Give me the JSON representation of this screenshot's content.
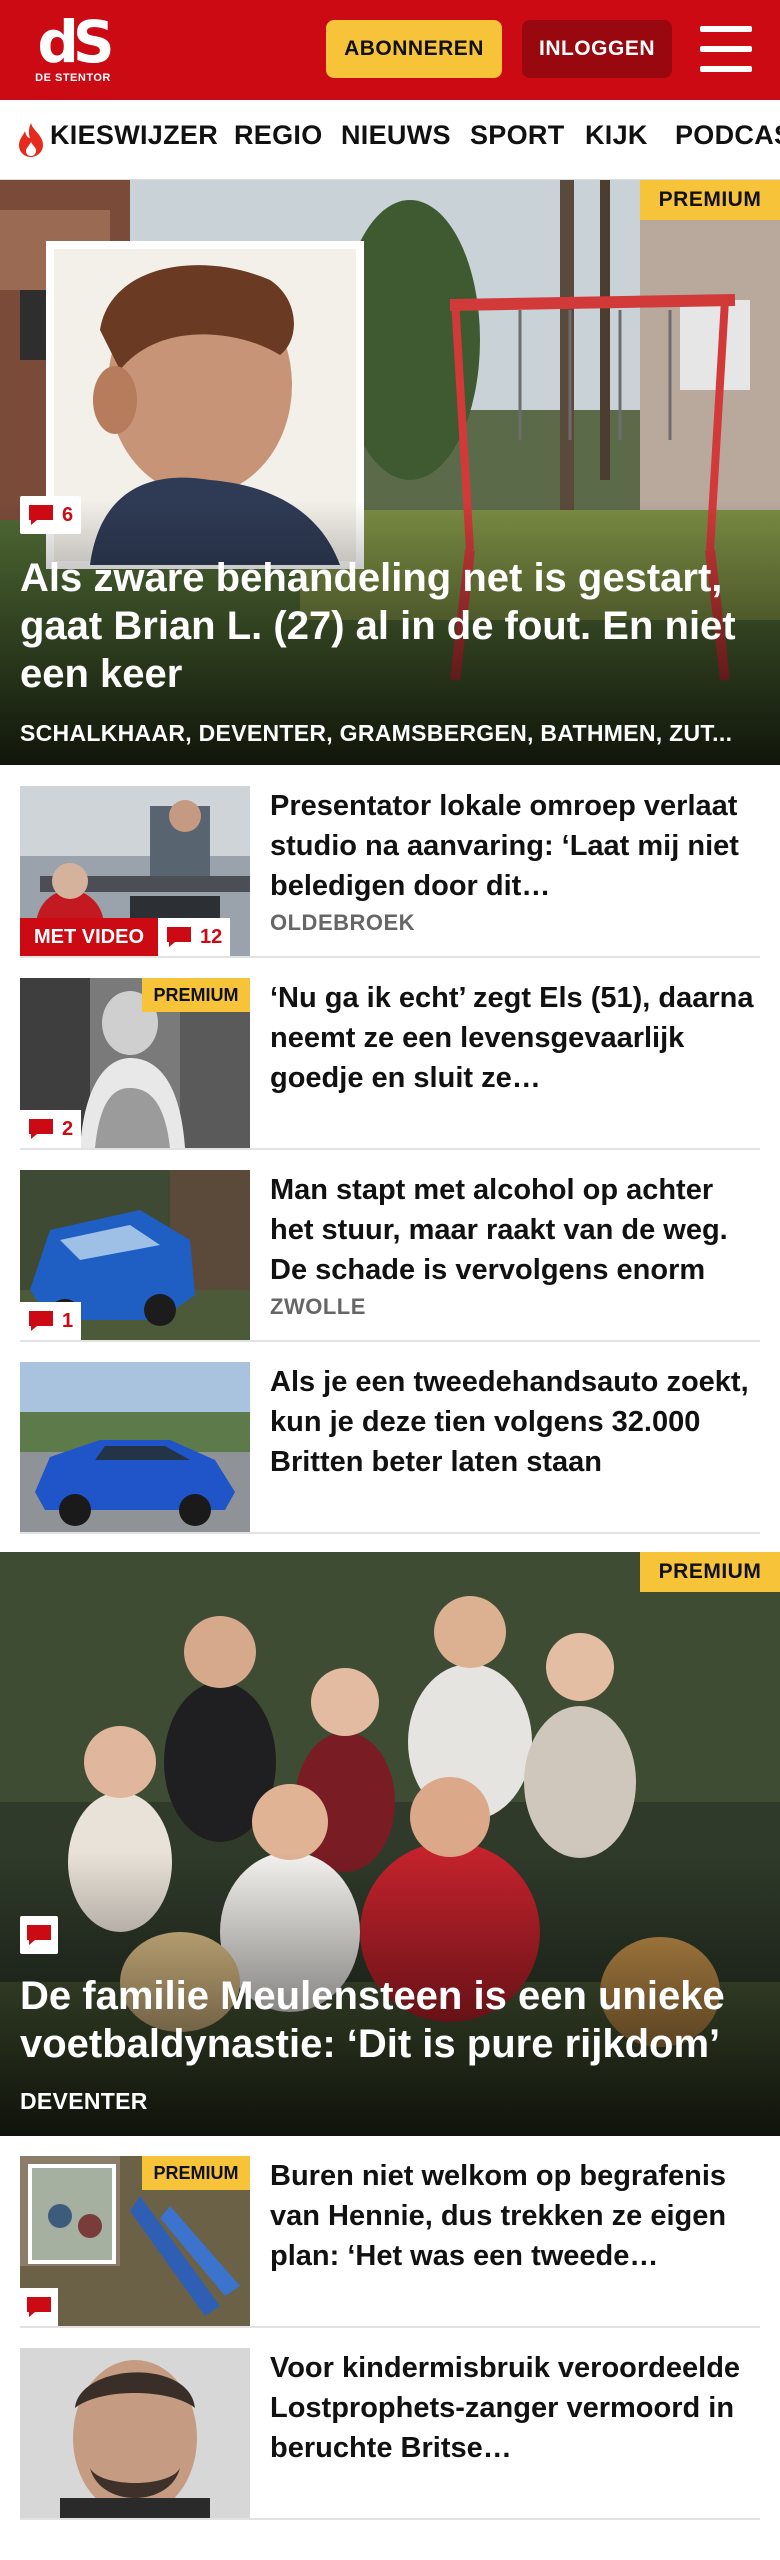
{
  "header": {
    "logo_text": "dS",
    "logo_sub": "DE STENTOR",
    "subscribe_label": "ABONNEREN",
    "login_label": "INLOGGEN",
    "menu_icon": "hamburger-icon",
    "brand_color": "#cc0a14"
  },
  "nav": {
    "items": [
      {
        "label": "KIESWIJZER",
        "icon": "flame-icon"
      },
      {
        "label": "REGIO"
      },
      {
        "label": "NIEUWS"
      },
      {
        "label": "SPORT"
      },
      {
        "label": "KIJK"
      },
      {
        "label": "PODCAS"
      }
    ]
  },
  "hero1": {
    "premium_label": "PREMIUM",
    "comment_count": "6",
    "title": "Als zware behandeling net is gestart, gaat Brian L. (27) al in de fout. En niet een keer",
    "location": "SCHALKHAAR, DEVENTER, GRAMSBERGEN, BATHMEN, ZUT..."
  },
  "articles": [
    {
      "title": "Presentator lokale omroep verlaat studio na aanvaring: ‘Laat mij niet beledigen door dit…",
      "location": "OLDEBROEK",
      "video_label": "MET VIDEO",
      "comment_count": "12"
    },
    {
      "title": "‘Nu ga ik echt’ zegt Els (51), daarna neemt ze een levensge­vaarlijk goedje en sluit ze…",
      "premium_label": "PREMIUM",
      "comment_count": "2"
    },
    {
      "title": "Man stapt met alcohol op achter het stuur, maar raakt van de weg. De schade is vervolgens enorm",
      "location": "ZWOLLE",
      "comment_count": "1"
    },
    {
      "title": "Als je een tweedehandsauto zoekt, kun je deze tien volgens 32.000 Britten beter laten staan"
    }
  ],
  "hero2": {
    "premium_label": "PREMIUM",
    "title": "De familie Meulensteen is een unieke voetbaldynastie: ‘Dit is pure rijkdom’",
    "location": "DEVENTER"
  },
  "articles2": [
    {
      "title": "Buren niet welkom op begrafenis van Hennie, dus trekken ze eigen plan: ‘Het was een tweede…",
      "premium_label": "PREMIUM"
    },
    {
      "title": "Voor kindermisbruik veroordeel­de Lostprophets-zanger vermoord in beruchte Britse…"
    }
  ]
}
